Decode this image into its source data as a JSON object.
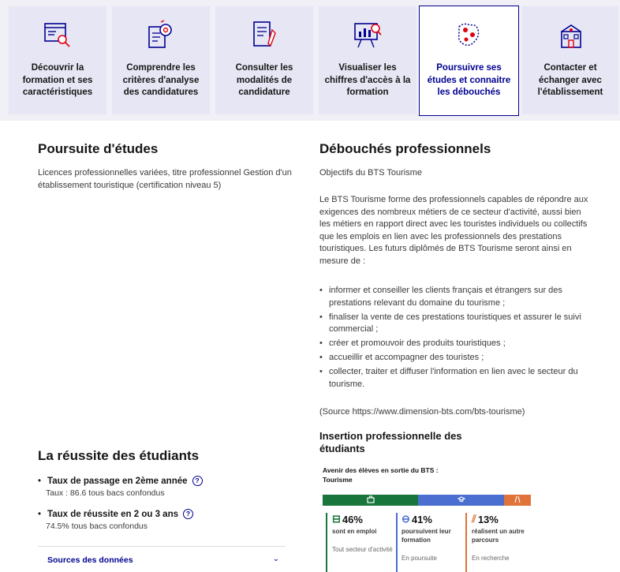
{
  "tabs": [
    {
      "label": "Découvrir la formation et ses caractéristiques",
      "icon": "computer-search-icon"
    },
    {
      "label": "Comprendre les critères d'analyse des candidatures",
      "icon": "document-gear-icon"
    },
    {
      "label": "Consulter les modalités de candidature",
      "icon": "document-pen-icon"
    },
    {
      "label": "Visualiser les chiffres d'accès à la formation",
      "icon": "chart-board-icon"
    },
    {
      "label": "Poursuivre ses études et connaitre les débouchés",
      "icon": "map-pins-icon",
      "active": true
    },
    {
      "label": "Contacter et échanger avec l'établissement",
      "icon": "school-building-icon"
    }
  ],
  "poursuite": {
    "title": "Poursuite d'études",
    "text": "Licences professionnelles variées, titre professionnel Gestion d'un établissement touristique (certification niveau 5)"
  },
  "debouches": {
    "title": "Débouchés professionnels",
    "objectifs": "Objectifs du BTS Tourisme",
    "intro": "Le BTS Tourisme forme des professionnels capables de répondre aux exigences des nombreux métiers de ce secteur d'activité, aussi bien les métiers en rapport direct avec les touristes individuels ou collectifs que les emplois en lien avec les professionnels des prestations touristiques. Les futurs diplômés de BTS Tourisme seront ainsi en mesure de :",
    "items": [
      "informer et conseiller les clients français et étrangers sur des prestations relevant du domaine du tourisme ;",
      "finaliser la vente de ces prestations touristiques et assurer le suivi commercial ;",
      "créer et promouvoir des produits touristiques ;",
      "accueillir et accompagner des touristes ;",
      "collecter, traiter et diffuser l'information en lien avec le secteur du tourisme."
    ],
    "source": "(Source https://www.dimension-bts.com/bts-tourisme)"
  },
  "insertion": {
    "title": "Insertion professionnelle des étudiants",
    "avenir": "Avenir des élèves en sortie du BTS : Tourisme",
    "colors": {
      "emploi": "#18753c",
      "poursuite": "#4a6fd0",
      "autre": "#e0733a"
    },
    "stats": [
      {
        "pct": "46%",
        "desc": "sont en emploi",
        "sub": "Tout secteur d'activité",
        "value": 46,
        "color": "#18753c",
        "icon": "briefcase-icon"
      },
      {
        "pct": "41%",
        "desc": "poursuivent leur formation",
        "sub": "En poursuite",
        "value": 41,
        "color": "#4a6fd0",
        "icon": "graduation-cap-icon"
      },
      {
        "pct": "13%",
        "desc": "réalisent un autre parcours",
        "sub": "En recherche",
        "value": 13,
        "color": "#e0733a",
        "icon": "route-icon"
      }
    ]
  },
  "reussite": {
    "title": "La réussite des étudiants",
    "passage_label": "Taux de passage en 2ème année",
    "passage_value": "Taux : 86.6 tous bacs confondus",
    "reussite_label": "Taux de réussite en 2 ou 3 ans",
    "reussite_value": "74.5% tous bacs confondus",
    "help": "?",
    "sources": "Sources des données"
  }
}
